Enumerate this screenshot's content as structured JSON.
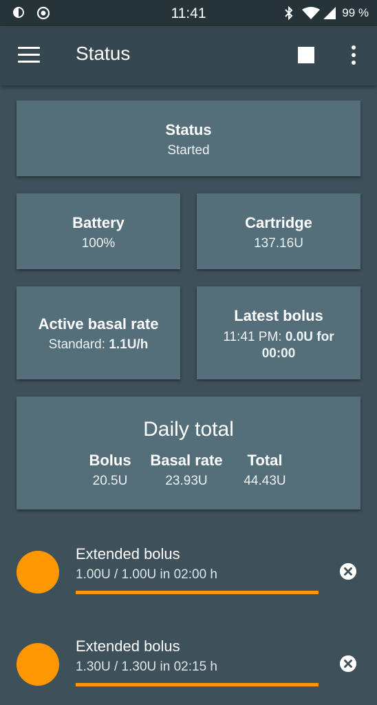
{
  "status_bar": {
    "time": "11:41",
    "battery": "99 %",
    "left_icons": [
      "data-saver-icon",
      "record-icon"
    ],
    "right_icons": [
      "bluetooth-icon",
      "wifi-icon",
      "signal-icon"
    ]
  },
  "app_bar": {
    "title": "Status",
    "menu_icon": "hamburger-menu-icon",
    "stop_icon": "stop-icon",
    "more_icon": "more-vertical-icon"
  },
  "status_card": {
    "title": "Status",
    "value": "Started"
  },
  "battery_card": {
    "title": "Battery",
    "value": "100%"
  },
  "cartridge_card": {
    "title": "Cartridge",
    "value": "137.16U"
  },
  "basal_card": {
    "title": "Active basal rate",
    "profile": "Standard: ",
    "rate": "1.1U/h"
  },
  "bolus_card": {
    "title": "Latest bolus",
    "time": "11:41 PM: ",
    "amount": "0.0U for",
    "duration": "00:00"
  },
  "daily_total": {
    "title": "Daily total",
    "columns": [
      {
        "label": "Bolus",
        "value": "20.5U"
      },
      {
        "label": "Basal rate",
        "value": "23.93U"
      },
      {
        "label": "Total",
        "value": "44.43U"
      }
    ]
  },
  "extended_boluses": [
    {
      "title": "Extended bolus",
      "detail": "1.00U / 1.00U in 02:00 h",
      "progress": 1.0
    },
    {
      "title": "Extended bolus",
      "detail": "1.30U / 1.30U in 02:15 h",
      "progress": 1.0
    }
  ],
  "colors": {
    "background": "#3e5059",
    "app_bar": "#37474f",
    "card": "#546e7a",
    "accent": "#ff9800"
  }
}
